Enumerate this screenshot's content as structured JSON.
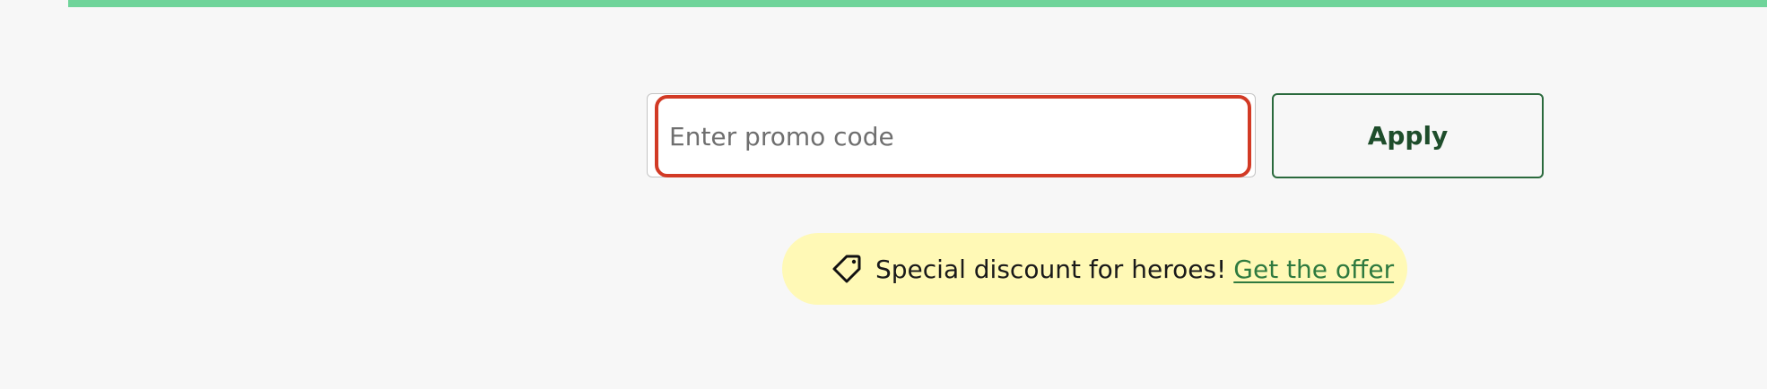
{
  "colors": {
    "top_bar": "#6fd49a",
    "background": "#f7f7f7",
    "input_error_border": "#d23a25",
    "apply_border": "#2b6a3d",
    "apply_text": "#1e4d2b",
    "banner_bg": "#fff9b6",
    "link": "#2f7a3f"
  },
  "promo": {
    "placeholder": "Enter promo code",
    "value": "",
    "apply_label": "Apply"
  },
  "offer": {
    "icon": "tag-icon",
    "text": "Special discount for heroes!",
    "link_label": "Get the offer"
  }
}
